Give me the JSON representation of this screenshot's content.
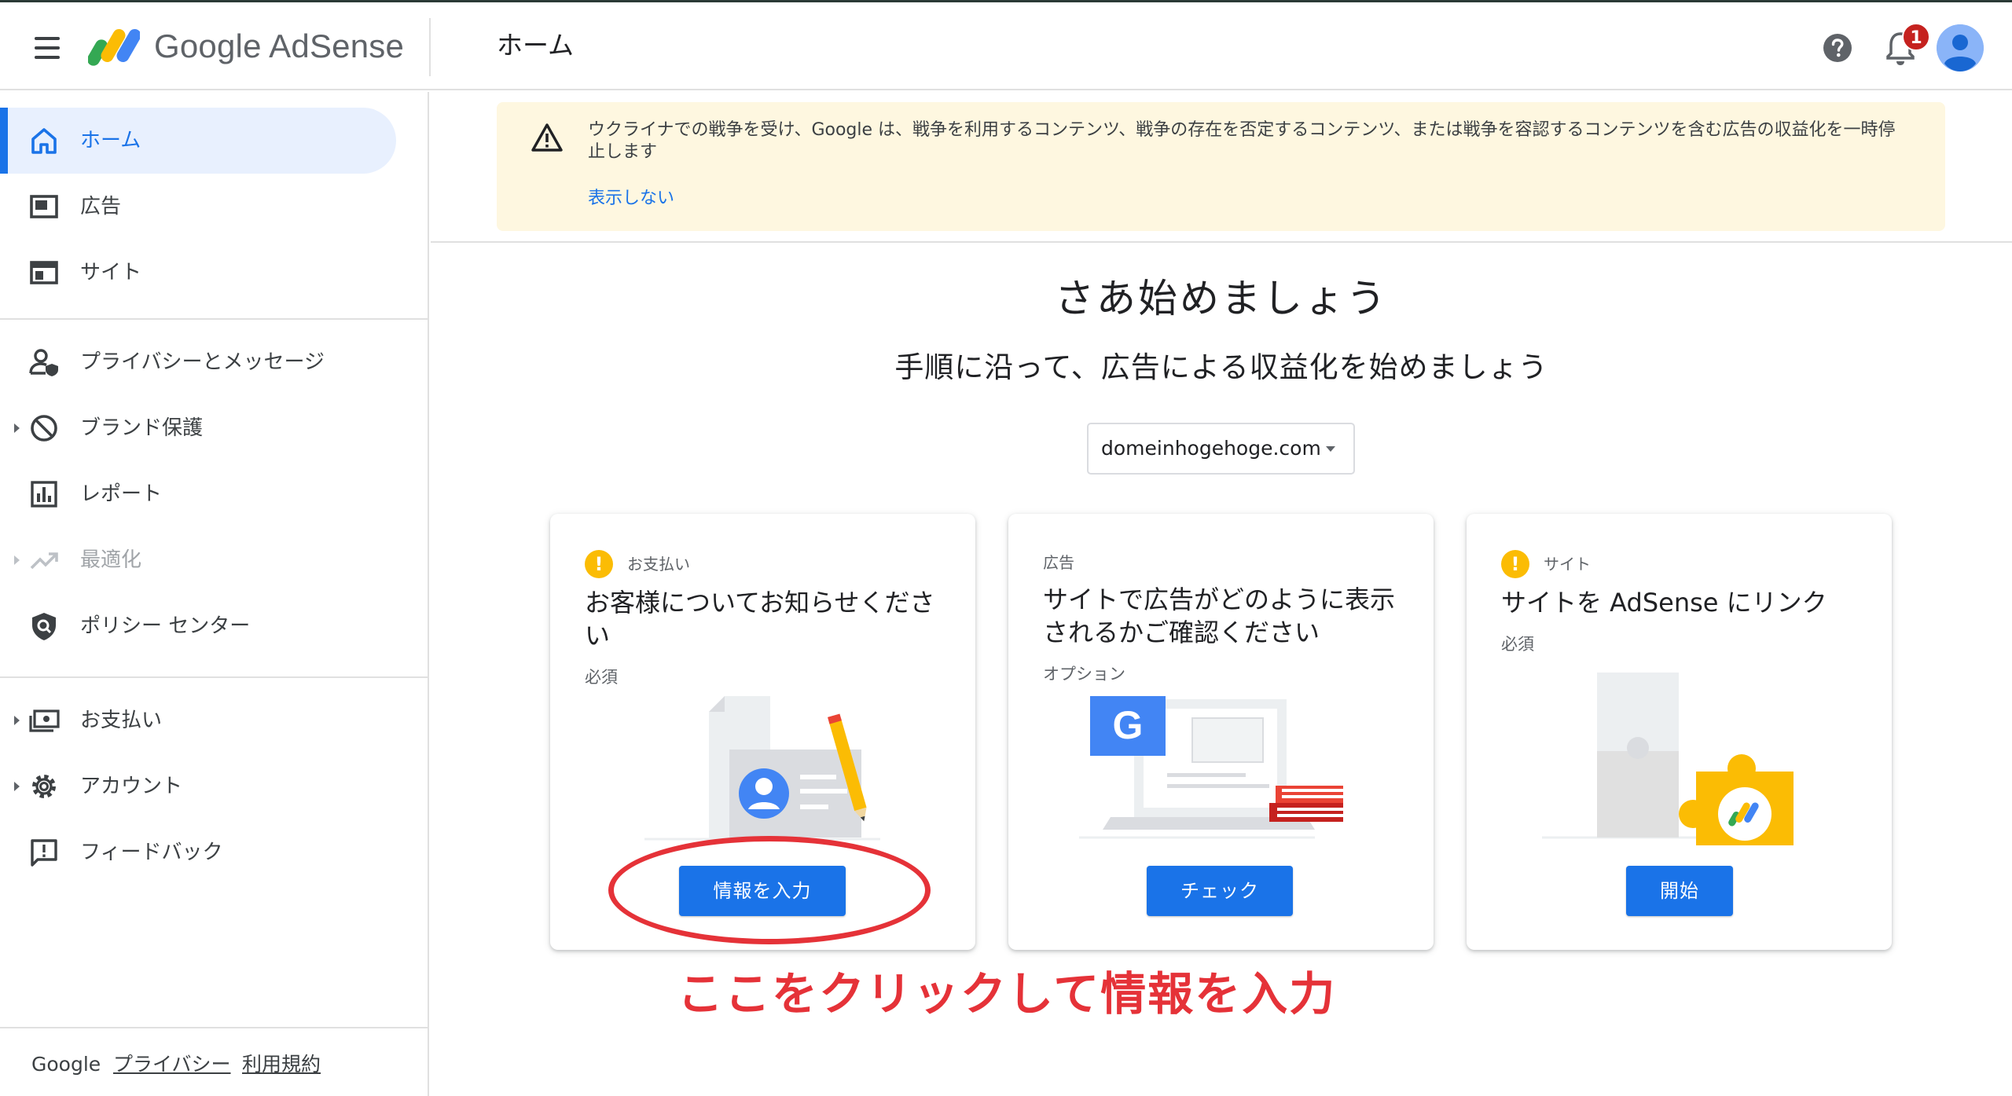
{
  "header": {
    "logo_text": "Google AdSense",
    "page_title": "ホーム",
    "notification_count": "1"
  },
  "sidebar": {
    "items": [
      {
        "label": "ホーム",
        "icon": "home-icon",
        "active": true
      },
      {
        "label": "広告",
        "icon": "ads-icon"
      },
      {
        "label": "サイト",
        "icon": "sites-icon"
      },
      {
        "label": "プライバシーとメッセージ",
        "icon": "privacy-icon"
      },
      {
        "label": "ブランド保護",
        "icon": "block-icon",
        "expandable": true
      },
      {
        "label": "レポート",
        "icon": "report-icon"
      },
      {
        "label": "最適化",
        "icon": "trending-icon",
        "expandable": true,
        "disabled": true
      },
      {
        "label": "ポリシー センター",
        "icon": "policy-shield-icon"
      },
      {
        "label": "お支払い",
        "icon": "payments-icon",
        "expandable": true
      },
      {
        "label": "アカウント",
        "icon": "gear-icon",
        "expandable": true
      },
      {
        "label": "フィードバック",
        "icon": "feedback-icon"
      }
    ],
    "footer": {
      "brand": "Google",
      "privacy": "プライバシー",
      "terms": "利用規約"
    }
  },
  "banner": {
    "text": "ウクライナでの戦争を受け、Google は、戦争を利用するコンテンツ、戦争の存在を否定するコンテンツ、または戦争を容認するコンテンツを含む広告の収益化を一時停止します",
    "dismiss": "表示しない"
  },
  "main": {
    "heading": "さあ始めましょう",
    "subheading": "手順に沿って、広告による収益化を始めましょう",
    "site_select": "domeinhogehoge.com"
  },
  "cards": [
    {
      "category": "お支払い",
      "title": "お客様についてお知らせください",
      "sub": "必須",
      "button": "情報を入力"
    },
    {
      "category": "広告",
      "title": "サイトで広告がどのように表示されるかご確認ください",
      "sub": "オプション",
      "button": "チェック"
    },
    {
      "category": "サイト",
      "title": "サイトを AdSense にリンク",
      "sub": "必須",
      "button": "開始"
    }
  ],
  "annotation": "ここをクリックして情報を入力",
  "colors": {
    "primary": "#1a73e8",
    "banner_bg": "#fef7e0",
    "warning": "#fbbc04",
    "annotation_red": "#e53238",
    "badge_red": "#c5221f"
  }
}
